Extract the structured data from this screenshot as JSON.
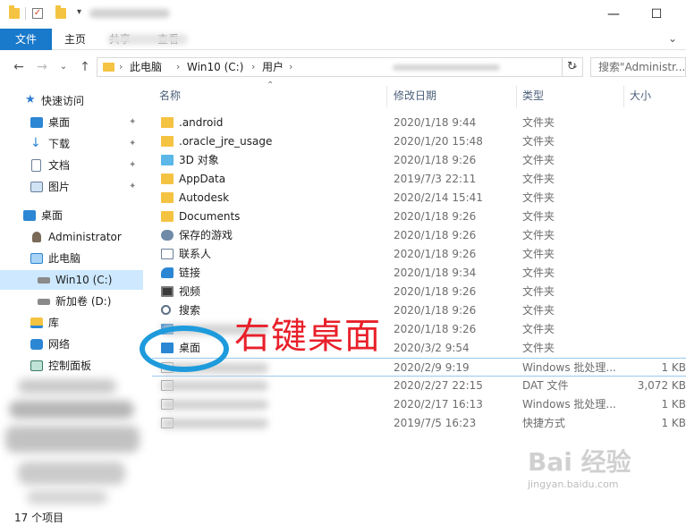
{
  "ribbon": {
    "tabs": [
      {
        "label": "文件"
      },
      {
        "label": "主页"
      },
      {
        "label": "共享"
      },
      {
        "label": "查看"
      }
    ]
  },
  "address": {
    "crumbs": [
      "此电脑",
      "Win10 (C:)",
      "用户"
    ],
    "search_placeholder": "搜索\"Administr..."
  },
  "sidebar": {
    "items": [
      {
        "label": "快速访问",
        "icon": "star-icon"
      },
      {
        "label": "桌面",
        "icon": "desktop-icon"
      },
      {
        "label": "下载",
        "icon": "download-icon"
      },
      {
        "label": "文档",
        "icon": "document-icon"
      },
      {
        "label": "图片",
        "icon": "pictures-icon"
      },
      {
        "label": "桌面",
        "icon": "desktop-icon"
      },
      {
        "label": "Administrator",
        "icon": "user-icon"
      },
      {
        "label": "此电脑",
        "icon": "computer-icon"
      },
      {
        "label": "Win10 (C:)",
        "icon": "drive-icon"
      },
      {
        "label": "新加卷 (D:)",
        "icon": "drive-icon"
      },
      {
        "label": "库",
        "icon": "library-icon"
      },
      {
        "label": "网络",
        "icon": "network-icon"
      },
      {
        "label": "控制面板",
        "icon": "control-panel-icon"
      }
    ]
  },
  "columns": {
    "name": "名称",
    "date": "修改日期",
    "type": "类型",
    "size": "大小"
  },
  "files": [
    {
      "name": ".android",
      "date": "2020/1/18 9:44",
      "type": "文件夹",
      "size": "",
      "icon": "folder-icon"
    },
    {
      "name": ".oracle_jre_usage",
      "date": "2020/1/20 15:48",
      "type": "文件夹",
      "size": "",
      "icon": "folder-icon"
    },
    {
      "name": "3D 对象",
      "date": "2020/1/18 9:26",
      "type": "文件夹",
      "size": "",
      "icon": "3d-objects-icon"
    },
    {
      "name": "AppData",
      "date": "2019/7/3 22:11",
      "type": "文件夹",
      "size": "",
      "icon": "folder-icon"
    },
    {
      "name": "Autodesk",
      "date": "2020/2/14 15:41",
      "type": "文件夹",
      "size": "",
      "icon": "folder-icon"
    },
    {
      "name": "Documents",
      "date": "2020/1/18 9:26",
      "type": "文件夹",
      "size": "",
      "icon": "folder-icon"
    },
    {
      "name": "保存的游戏",
      "date": "2020/1/18 9:26",
      "type": "文件夹",
      "size": "",
      "icon": "saved-games-icon"
    },
    {
      "name": "联系人",
      "date": "2020/1/18 9:26",
      "type": "文件夹",
      "size": "",
      "icon": "contacts-icon"
    },
    {
      "name": "链接",
      "date": "2020/1/18 9:34",
      "type": "文件夹",
      "size": "",
      "icon": "links-icon"
    },
    {
      "name": "视频",
      "date": "2020/1/18 9:26",
      "type": "文件夹",
      "size": "",
      "icon": "videos-icon"
    },
    {
      "name": "搜索",
      "date": "2020/1/18 9:26",
      "type": "文件夹",
      "size": "",
      "icon": "search-icon"
    },
    {
      "name": "",
      "date": "2020/1/18 9:26",
      "type": "文件夹",
      "size": "",
      "icon": "music-icon"
    },
    {
      "name": "桌面",
      "date": "2020/3/2 9:54",
      "type": "文件夹",
      "size": "",
      "icon": "desktop-icon"
    },
    {
      "name": "",
      "date": "2020/2/9 9:19",
      "type": "Windows 批处理...",
      "size": "1 KB",
      "icon": "file-icon"
    },
    {
      "name": "",
      "date": "2020/2/27 22:15",
      "type": "DAT 文件",
      "size": "3,072 KB",
      "icon": "file-icon"
    },
    {
      "name": "",
      "date": "2020/2/17 16:13",
      "type": "Windows 批处理...",
      "size": "1 KB",
      "icon": "file-icon"
    },
    {
      "name": "",
      "date": "2019/7/5 16:23",
      "type": "快捷方式",
      "size": "1 KB",
      "icon": "shortcut-icon"
    }
  ],
  "annotation": {
    "text": "右键桌面",
    "color": "#e8202a",
    "circle_color": "#1e9bdc"
  },
  "status": {
    "count": "17 个项目"
  },
  "watermark": {
    "main": "Bai 经验",
    "sub": "jingyan.baidu.com"
  },
  "colors": {
    "accent": "#1979ca",
    "folder": "#f5c342",
    "selection": "#cde8ff"
  }
}
